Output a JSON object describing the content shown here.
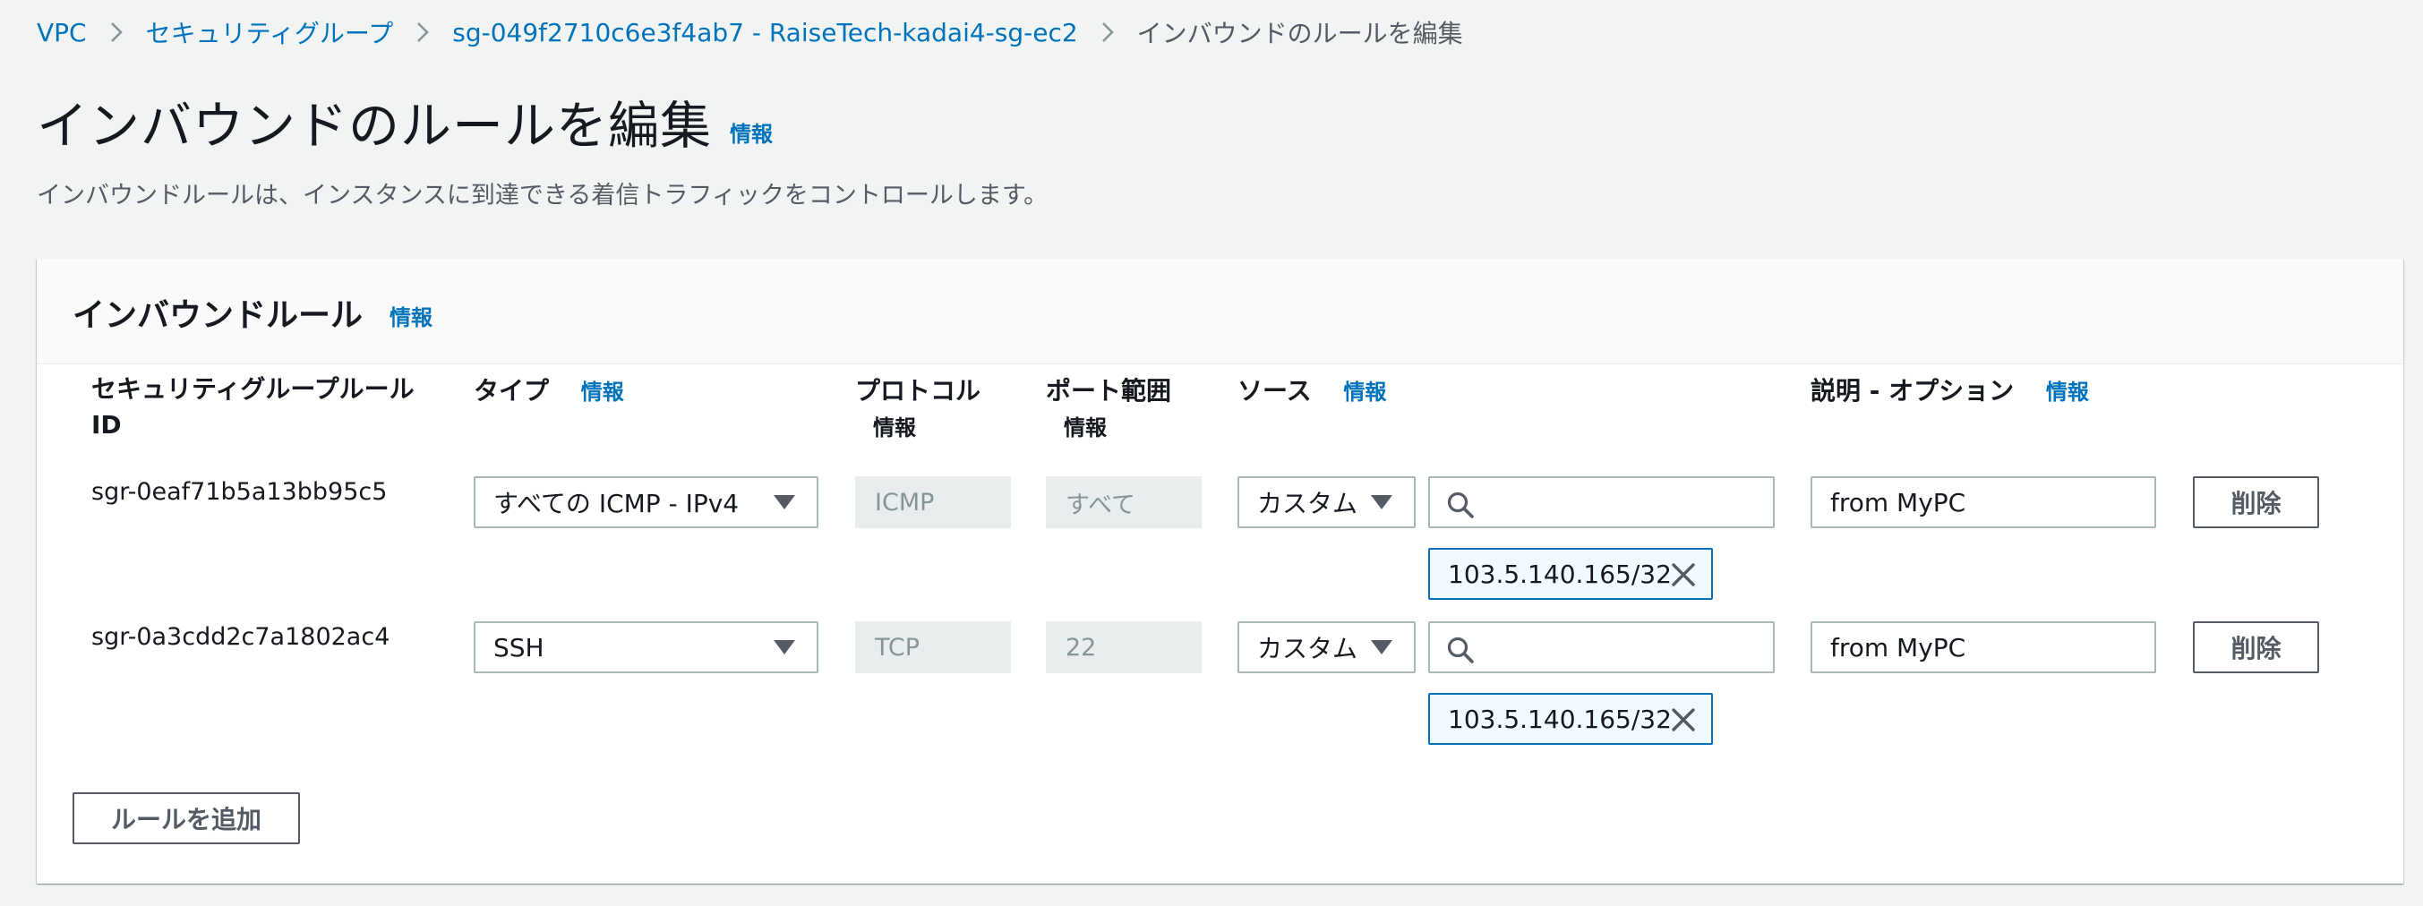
{
  "breadcrumb": {
    "items": [
      "VPC",
      "セキュリティグループ",
      "sg-049f2710c6e3f4ab7 - RaiseTech-kadai4-sg-ec2"
    ],
    "current": "インバウンドのルールを編集"
  },
  "page": {
    "title": "インバウンドのルールを編集",
    "info": "情報",
    "description": "インバウンドルールは、インスタンスに到達できる着信トラフィックをコントロールします。"
  },
  "panel": {
    "title": "インバウンドルール",
    "info": "情報"
  },
  "columns": {
    "rule_id": "セキュリティグループルール ID",
    "type": "タイプ",
    "type_info": "情報",
    "protocol": "プロトコル",
    "protocol_info": "情報",
    "port_range": "ポート範囲",
    "port_range_info": "情報",
    "source": "ソース",
    "source_info": "情報",
    "description": "説明 - オプション",
    "description_info": "情報"
  },
  "rules": [
    {
      "id": "sgr-0eaf71b5a13bb95c5",
      "type": "すべての ICMP - IPv4",
      "protocol": "ICMP",
      "port_range": "すべて",
      "source_type": "カスタム",
      "source_search_value": "",
      "source_token": "103.5.140.165/32",
      "description": "from MyPC",
      "delete_label": "削除"
    },
    {
      "id": "sgr-0a3cdd2c7a1802ac4",
      "type": "SSH",
      "protocol": "TCP",
      "port_range": "22",
      "source_type": "カスタム",
      "source_search_value": "",
      "source_token": "103.5.140.165/32",
      "description": "from MyPC",
      "delete_label": "削除"
    }
  ],
  "actions": {
    "add_rule_label": "ルールを追加"
  },
  "icons": {
    "chevron": "chevron-right-icon",
    "caret": "caret-down-icon",
    "search": "search-icon",
    "dismiss": "close-icon"
  },
  "colors": {
    "link": "#0073bb",
    "background": "#f2f3f3",
    "panel": "#ffffff",
    "border": "#aab7b8",
    "token_border": "#0073bb",
    "token_bg": "#f1faff",
    "readonly_bg": "#eaeded"
  }
}
